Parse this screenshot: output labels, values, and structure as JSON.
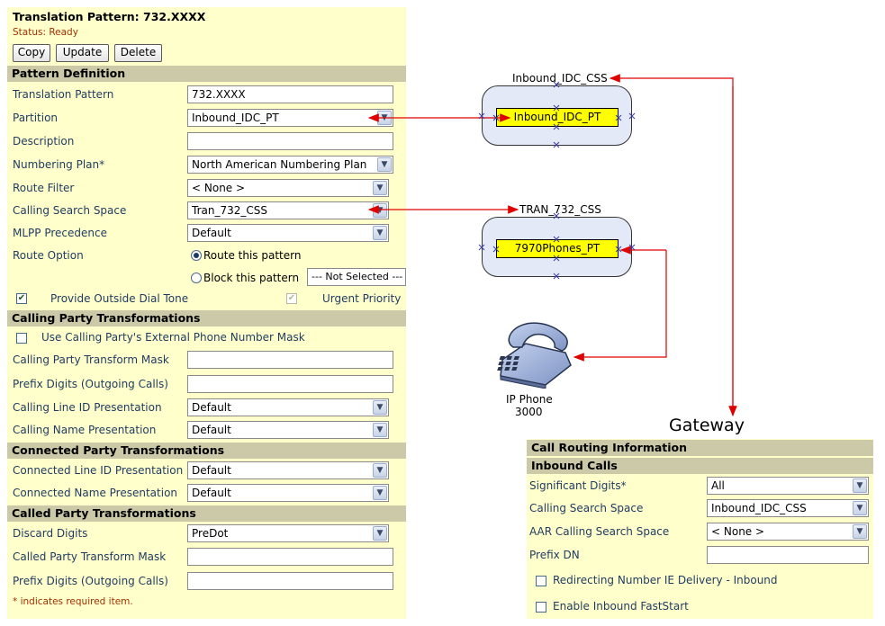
{
  "translation_pattern": {
    "title": "Translation Pattern:  732.XXXX",
    "status": "Status:  Ready",
    "buttons": {
      "copy": "Copy",
      "update": "Update",
      "delete": "Delete"
    },
    "pattern_definition": {
      "header": "Pattern Definition",
      "translation_pattern_label": "Translation Pattern",
      "translation_pattern_value": "732.XXXX",
      "partition_label": "Partition",
      "partition_value": "Inbound_IDC_PT",
      "description_label": "Description",
      "description_value": "",
      "numbering_plan_label": "Numbering Plan*",
      "numbering_plan_value": "North American Numbering Plan",
      "route_filter_label": "Route Filter",
      "route_filter_value": "< None >",
      "css_label": "Calling Search Space",
      "css_value": "Tran_732_CSS",
      "mlpp_label": "MLPP Precedence",
      "mlpp_value": "Default",
      "route_option_label": "Route Option",
      "route_this_pattern": "Route this pattern",
      "block_this_pattern": "Block this pattern",
      "block_reason_value": "--- Not Selected ---",
      "provide_outside_dial_tone": "Provide Outside Dial Tone",
      "urgent_priority": "Urgent Priority"
    },
    "calling_party": {
      "header": "Calling Party Transformations",
      "use_external_mask": "Use Calling Party's External Phone Number Mask",
      "transform_mask_label": "Calling Party Transform Mask",
      "prefix_digits_label": "Prefix Digits (Outgoing Calls)",
      "line_id_presentation_label": "Calling Line ID Presentation",
      "line_id_presentation_value": "Default",
      "name_presentation_label": "Calling Name Presentation",
      "name_presentation_value": "Default"
    },
    "connected_party": {
      "header": "Connected Party Transformations",
      "line_id_presentation_label": "Connected Line ID Presentation",
      "line_id_presentation_value": "Default",
      "name_presentation_label": "Connected Name Presentation",
      "name_presentation_value": "Default"
    },
    "called_party": {
      "header": "Called Party Transformations",
      "discard_digits_label": "Discard Digits",
      "discard_digits_value": "PreDot",
      "transform_mask_label": "Called Party Transform Mask",
      "prefix_digits_label": "Prefix Digits (Outgoing Calls)"
    },
    "required_note": "* indicates required item."
  },
  "diagram": {
    "css1_label": "Inbound_IDC_CSS",
    "pt1_label": "Inbound_IDC_PT",
    "css2_label": "TRAN_732_CSS",
    "pt2_label": "7970Phones_PT",
    "phone_label_line1": "IP Phone",
    "phone_label_line2": "3000",
    "gateway_label": "Gateway",
    "colors": {
      "arrow": "#e00000",
      "partition_fill": "#ffff00",
      "css_fill": "#e4e9f7"
    }
  },
  "gateway": {
    "header": "Call Routing Information",
    "subheader": "Inbound Calls",
    "significant_digits_label": "Significant Digits*",
    "significant_digits_value": "All",
    "css_label": "Calling Search Space",
    "css_value": "Inbound_IDC_CSS",
    "aar_css_label": "AAR Calling Search Space",
    "aar_css_value": "< None >",
    "prefix_dn_label": "Prefix DN",
    "prefix_dn_value": "",
    "redirecting_ie": "Redirecting Number IE Delivery - Inbound",
    "enable_faststart": "Enable Inbound FastStart"
  }
}
